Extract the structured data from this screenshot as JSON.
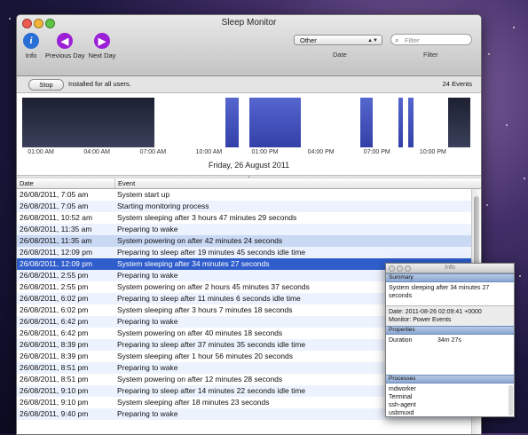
{
  "window": {
    "title": "Sleep Monitor",
    "toolbar": {
      "info_label": "Info",
      "prev_label": "Previous Day",
      "next_label": "Next Day",
      "filter_value": "Other",
      "date_label": "Date",
      "search_placeholder": "Filter",
      "filter_label": "Filter"
    },
    "status": {
      "stop_label": "Stop",
      "message": "Installed for all users.",
      "event_count": "24 Events"
    },
    "timeline": {
      "date": "Friday, 26 August 2011",
      "ticks": [
        "01:00 AM",
        "04:00 AM",
        "07:00 AM",
        "10:00 AM",
        "01:00 PM",
        "04:00 PM",
        "07:00 PM",
        "10:00 PM"
      ],
      "blocks": [
        {
          "start": 0.0,
          "end": 7.08,
          "kind": "dark"
        },
        {
          "start": 10.87,
          "end": 11.58,
          "kind": "blue"
        },
        {
          "start": 12.15,
          "end": 14.93,
          "kind": "blue"
        },
        {
          "start": 18.1,
          "end": 18.75,
          "kind": "blue"
        },
        {
          "start": 20.15,
          "end": 20.4,
          "kind": "blue"
        },
        {
          "start": 20.65,
          "end": 20.95,
          "kind": "blue"
        },
        {
          "start": 22.8,
          "end": 24.0,
          "kind": "dark"
        }
      ]
    },
    "table": {
      "col_date": "Date",
      "col_event": "Event",
      "rows": [
        {
          "date": "26/08/2011, 7:05 am",
          "event": "System start up"
        },
        {
          "date": "26/08/2011, 7:05 am",
          "event": "Starting monitoring process"
        },
        {
          "date": "26/08/2011, 10:52 am",
          "event": "System sleeping after 3 hours 47 minutes 29 seconds"
        },
        {
          "date": "26/08/2011, 11:35 am",
          "event": "Preparing to wake"
        },
        {
          "date": "26/08/2011, 11:35 am",
          "event": "System powering on after 42 minutes 24 seconds"
        },
        {
          "date": "26/08/2011, 12:09 pm",
          "event": "Preparing to sleep after 19 minutes 45 seconds idle time"
        },
        {
          "date": "26/08/2011, 12:09 pm",
          "event": "System sleeping after 34 minutes 27 seconds"
        },
        {
          "date": "26/08/2011, 2:55 pm",
          "event": "Preparing to wake"
        },
        {
          "date": "26/08/2011, 2:55 pm",
          "event": "System powering on after 2 hours 45 minutes 37 seconds"
        },
        {
          "date": "26/08/2011, 6:02 pm",
          "event": "Preparing to sleep after 11 minutes 6 seconds idle time"
        },
        {
          "date": "26/08/2011, 6:02 pm",
          "event": "System sleeping after 3 hours 7 minutes 18 seconds"
        },
        {
          "date": "26/08/2011, 6:42 pm",
          "event": "Preparing to wake"
        },
        {
          "date": "26/08/2011, 6:42 pm",
          "event": "System powering on after 40 minutes 18 seconds"
        },
        {
          "date": "26/08/2011, 8:39 pm",
          "event": "Preparing to sleep after 37 minutes 35 seconds idle time"
        },
        {
          "date": "26/08/2011, 8:39 pm",
          "event": "System sleeping after 1 hour 56 minutes 20 seconds"
        },
        {
          "date": "26/08/2011, 8:51 pm",
          "event": "Preparing to wake"
        },
        {
          "date": "26/08/2011, 8:51 pm",
          "event": "System powering on after 12 minutes 28 seconds"
        },
        {
          "date": "26/08/2011, 9:10 pm",
          "event": "Preparing to sleep after 14 minutes 22 seconds idle time"
        },
        {
          "date": "26/08/2011, 9:10 pm",
          "event": "System sleeping after 18 minutes 23 seconds"
        },
        {
          "date": "26/08/2011, 9:40 pm",
          "event": "Preparing to wake"
        }
      ],
      "selected_index": 6,
      "highlighted_index": 4
    }
  },
  "info_panel": {
    "title": "Info",
    "summary_header": "Summary",
    "summary_text": "System sleeping after 34 minutes 27 seconds",
    "date_line": "Date: 2011-08-26 02:09:41 +0000",
    "monitor_line": "Monitor: Power Events",
    "properties_header": "Properties",
    "property_name": "Duration",
    "property_value": "34m 27s",
    "processes_header": "Processes",
    "processes": [
      "mdworker",
      "Terminal",
      "ssh-agent",
      "usbmuxd"
    ]
  },
  "colors": {
    "selection": "#2f5dcb",
    "block_dark": "#222639",
    "block_blue": "#4656bf",
    "nav_purple": "#9b1fd6",
    "info_blue": "#2a6fd6"
  }
}
